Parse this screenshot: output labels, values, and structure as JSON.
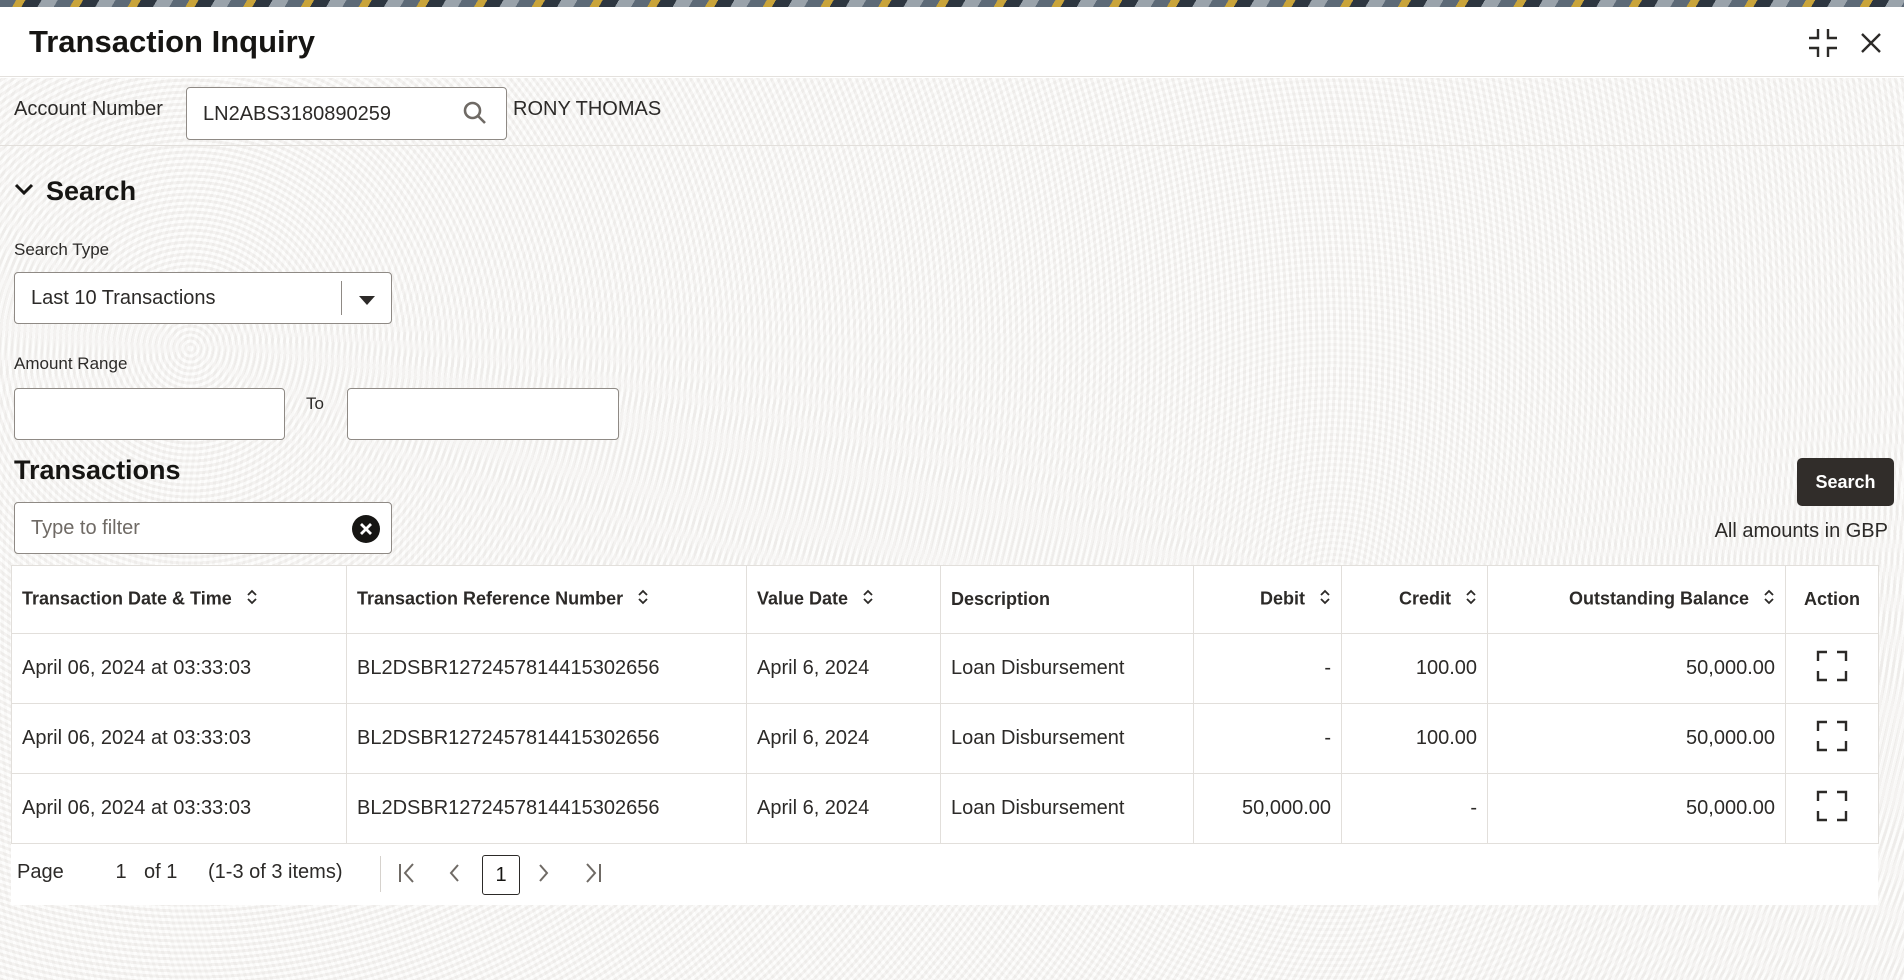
{
  "header": {
    "title": "Transaction Inquiry",
    "maximize_icon": "maximize-icon",
    "close_icon": "close-icon"
  },
  "account": {
    "label": "Account Number",
    "value": "LN2ABS3180890259",
    "name": "RONY THOMAS",
    "search_icon": "search-icon"
  },
  "search": {
    "section_title": "Search",
    "search_type_label": "Search Type",
    "search_type_value": "Last 10 Transactions",
    "amount_range_label": "Amount Range",
    "to_label": "To",
    "amount_from": "",
    "amount_to": "",
    "button_label": "Search"
  },
  "transactions": {
    "title": "Transactions",
    "filter_placeholder": "Type to filter",
    "currency_note": "All amounts in GBP",
    "columns": [
      "Transaction Date & Time",
      "Transaction Reference Number",
      "Value Date",
      "Description",
      "Debit",
      "Credit",
      "Outstanding Balance",
      "Action"
    ],
    "rows": [
      {
        "datetime": "April 06, 2024 at 03:33:03",
        "ref": "BL2DSBR1272457814415302656",
        "value_date": "April 6, 2024",
        "description": "Loan Disbursement",
        "debit": "-",
        "credit": "100.00",
        "balance": "50,000.00"
      },
      {
        "datetime": "April 06, 2024 at 03:33:03",
        "ref": "BL2DSBR1272457814415302656",
        "value_date": "April 6, 2024",
        "description": "Loan Disbursement",
        "debit": "-",
        "credit": "100.00",
        "balance": "50,000.00"
      },
      {
        "datetime": "April 06, 2024 at 03:33:03",
        "ref": "BL2DSBR1272457814415302656",
        "value_date": "April 6, 2024",
        "description": "Loan Disbursement",
        "debit": "50,000.00",
        "credit": "-",
        "balance": "50,000.00"
      }
    ]
  },
  "pagination": {
    "page_label": "Page",
    "page_number": "1",
    "of_label": "of 1",
    "items_label": "(1-3 of 3 items)",
    "current_page": "1"
  },
  "colors": {
    "primary_button": "#312d2a",
    "text": "#2c2a28",
    "border": "#8f8a85"
  }
}
